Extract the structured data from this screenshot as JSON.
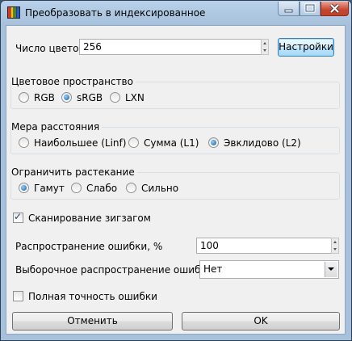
{
  "window": {
    "title": "Преобразовать в индексированное",
    "title_icon": "palette-icon"
  },
  "colors": {
    "label": "Число цветов",
    "value": "256",
    "settings_button": "Настройки"
  },
  "color_space": {
    "title": "Цветовое пространство",
    "options": [
      "RGB",
      "sRGB",
      "LXN"
    ],
    "selected": "sRGB"
  },
  "distance": {
    "title": "Мера расстояния",
    "options": [
      "Наибольшее (Linf)",
      "Сумма (L1)",
      "Эвклидово (L2)"
    ],
    "selected": "Эвклидово (L2)"
  },
  "spread": {
    "title": "Ограничить растекание",
    "options": [
      "Гамут",
      "Слабо",
      "Сильно"
    ],
    "selected": "Гамут"
  },
  "zigzag": {
    "label": "Сканирование зигзагом",
    "checked": true
  },
  "error_diffusion": {
    "label": "Распространение ошибки, %",
    "value": "100"
  },
  "selective_diffusion": {
    "label": "Выборочное распространение ошибки",
    "value": "Нет"
  },
  "full_precision": {
    "label": "Полная точность ошибки",
    "checked": false
  },
  "buttons": {
    "cancel": "Отменить",
    "ok": "OK"
  }
}
